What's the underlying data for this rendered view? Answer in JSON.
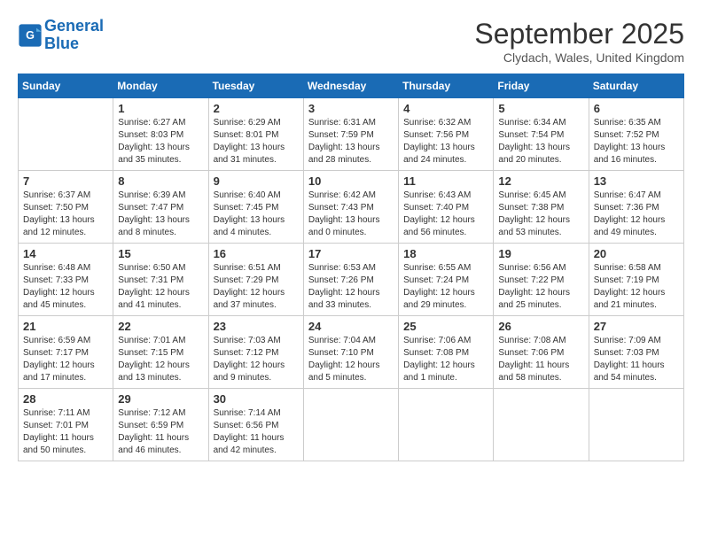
{
  "header": {
    "logo_line1": "General",
    "logo_line2": "Blue",
    "month": "September 2025",
    "location": "Clydach, Wales, United Kingdom"
  },
  "days_of_week": [
    "Sunday",
    "Monday",
    "Tuesday",
    "Wednesday",
    "Thursday",
    "Friday",
    "Saturday"
  ],
  "weeks": [
    [
      {
        "day": "",
        "info": ""
      },
      {
        "day": "1",
        "info": "Sunrise: 6:27 AM\nSunset: 8:03 PM\nDaylight: 13 hours\nand 35 minutes."
      },
      {
        "day": "2",
        "info": "Sunrise: 6:29 AM\nSunset: 8:01 PM\nDaylight: 13 hours\nand 31 minutes."
      },
      {
        "day": "3",
        "info": "Sunrise: 6:31 AM\nSunset: 7:59 PM\nDaylight: 13 hours\nand 28 minutes."
      },
      {
        "day": "4",
        "info": "Sunrise: 6:32 AM\nSunset: 7:56 PM\nDaylight: 13 hours\nand 24 minutes."
      },
      {
        "day": "5",
        "info": "Sunrise: 6:34 AM\nSunset: 7:54 PM\nDaylight: 13 hours\nand 20 minutes."
      },
      {
        "day": "6",
        "info": "Sunrise: 6:35 AM\nSunset: 7:52 PM\nDaylight: 13 hours\nand 16 minutes."
      }
    ],
    [
      {
        "day": "7",
        "info": "Sunrise: 6:37 AM\nSunset: 7:50 PM\nDaylight: 13 hours\nand 12 minutes."
      },
      {
        "day": "8",
        "info": "Sunrise: 6:39 AM\nSunset: 7:47 PM\nDaylight: 13 hours\nand 8 minutes."
      },
      {
        "day": "9",
        "info": "Sunrise: 6:40 AM\nSunset: 7:45 PM\nDaylight: 13 hours\nand 4 minutes."
      },
      {
        "day": "10",
        "info": "Sunrise: 6:42 AM\nSunset: 7:43 PM\nDaylight: 13 hours\nand 0 minutes."
      },
      {
        "day": "11",
        "info": "Sunrise: 6:43 AM\nSunset: 7:40 PM\nDaylight: 12 hours\nand 56 minutes."
      },
      {
        "day": "12",
        "info": "Sunrise: 6:45 AM\nSunset: 7:38 PM\nDaylight: 12 hours\nand 53 minutes."
      },
      {
        "day": "13",
        "info": "Sunrise: 6:47 AM\nSunset: 7:36 PM\nDaylight: 12 hours\nand 49 minutes."
      }
    ],
    [
      {
        "day": "14",
        "info": "Sunrise: 6:48 AM\nSunset: 7:33 PM\nDaylight: 12 hours\nand 45 minutes."
      },
      {
        "day": "15",
        "info": "Sunrise: 6:50 AM\nSunset: 7:31 PM\nDaylight: 12 hours\nand 41 minutes."
      },
      {
        "day": "16",
        "info": "Sunrise: 6:51 AM\nSunset: 7:29 PM\nDaylight: 12 hours\nand 37 minutes."
      },
      {
        "day": "17",
        "info": "Sunrise: 6:53 AM\nSunset: 7:26 PM\nDaylight: 12 hours\nand 33 minutes."
      },
      {
        "day": "18",
        "info": "Sunrise: 6:55 AM\nSunset: 7:24 PM\nDaylight: 12 hours\nand 29 minutes."
      },
      {
        "day": "19",
        "info": "Sunrise: 6:56 AM\nSunset: 7:22 PM\nDaylight: 12 hours\nand 25 minutes."
      },
      {
        "day": "20",
        "info": "Sunrise: 6:58 AM\nSunset: 7:19 PM\nDaylight: 12 hours\nand 21 minutes."
      }
    ],
    [
      {
        "day": "21",
        "info": "Sunrise: 6:59 AM\nSunset: 7:17 PM\nDaylight: 12 hours\nand 17 minutes."
      },
      {
        "day": "22",
        "info": "Sunrise: 7:01 AM\nSunset: 7:15 PM\nDaylight: 12 hours\nand 13 minutes."
      },
      {
        "day": "23",
        "info": "Sunrise: 7:03 AM\nSunset: 7:12 PM\nDaylight: 12 hours\nand 9 minutes."
      },
      {
        "day": "24",
        "info": "Sunrise: 7:04 AM\nSunset: 7:10 PM\nDaylight: 12 hours\nand 5 minutes."
      },
      {
        "day": "25",
        "info": "Sunrise: 7:06 AM\nSunset: 7:08 PM\nDaylight: 12 hours\nand 1 minute."
      },
      {
        "day": "26",
        "info": "Sunrise: 7:08 AM\nSunset: 7:06 PM\nDaylight: 11 hours\nand 58 minutes."
      },
      {
        "day": "27",
        "info": "Sunrise: 7:09 AM\nSunset: 7:03 PM\nDaylight: 11 hours\nand 54 minutes."
      }
    ],
    [
      {
        "day": "28",
        "info": "Sunrise: 7:11 AM\nSunset: 7:01 PM\nDaylight: 11 hours\nand 50 minutes."
      },
      {
        "day": "29",
        "info": "Sunrise: 7:12 AM\nSunset: 6:59 PM\nDaylight: 11 hours\nand 46 minutes."
      },
      {
        "day": "30",
        "info": "Sunrise: 7:14 AM\nSunset: 6:56 PM\nDaylight: 11 hours\nand 42 minutes."
      },
      {
        "day": "",
        "info": ""
      },
      {
        "day": "",
        "info": ""
      },
      {
        "day": "",
        "info": ""
      },
      {
        "day": "",
        "info": ""
      }
    ]
  ]
}
